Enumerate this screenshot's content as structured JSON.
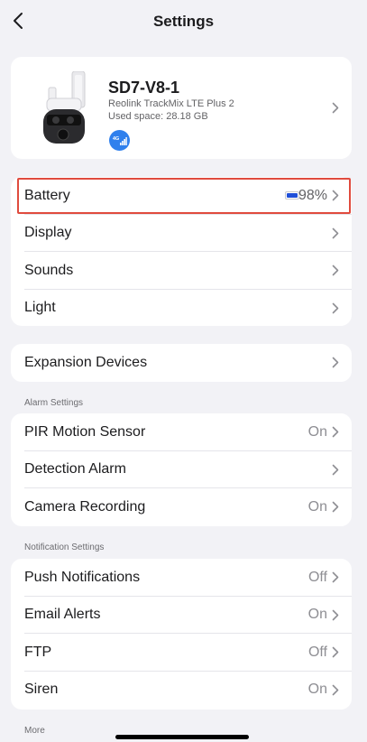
{
  "header": {
    "title": "Settings"
  },
  "device": {
    "name": "SD7-V8-1",
    "model": "Reolink TrackMix LTE Plus 2",
    "used_space": "Used space: 28.18 GB",
    "badge": "4G"
  },
  "group_main": {
    "battery": {
      "label": "Battery",
      "value": "98%",
      "level": 0.98
    },
    "display": {
      "label": "Display"
    },
    "sounds": {
      "label": "Sounds"
    },
    "light": {
      "label": "Light"
    }
  },
  "expansion": {
    "label": "Expansion Devices"
  },
  "alarm": {
    "section_title": "Alarm Settings",
    "pir": {
      "label": "PIR Motion Sensor",
      "value": "On"
    },
    "detection": {
      "label": "Detection Alarm"
    },
    "recording": {
      "label": "Camera Recording",
      "value": "On"
    }
  },
  "notification": {
    "section_title": "Notification Settings",
    "push": {
      "label": "Push Notifications",
      "value": "Off"
    },
    "email": {
      "label": "Email Alerts",
      "value": "On"
    },
    "ftp": {
      "label": "FTP",
      "value": "Off"
    },
    "siren": {
      "label": "Siren",
      "value": "On"
    }
  },
  "more": {
    "section_title": "More"
  },
  "colors": {
    "background": "#f2f2f6",
    "card": "#ffffff",
    "highlight": "#e04b3e",
    "accent": "#2f80ed",
    "battery_fill": "#1f4fd8"
  },
  "icons": {
    "back": "chevron-left-icon",
    "chevron": "chevron-right-icon",
    "battery": "battery-icon",
    "signal": "signal-4g-icon"
  }
}
